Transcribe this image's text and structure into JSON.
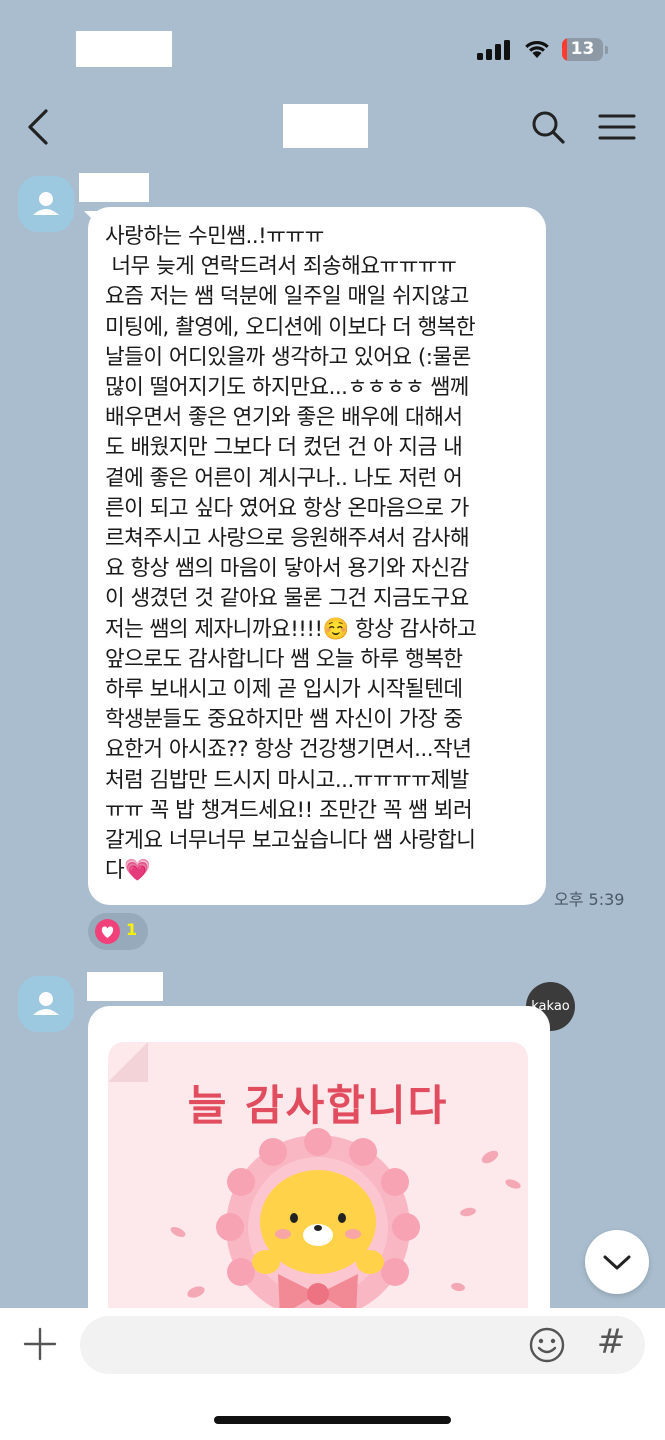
{
  "status_bar": {
    "battery_level": "13",
    "battery_level_fraction": 0.13
  },
  "header": {
    "back_icon": "chevron-left-icon",
    "search_icon": "search-icon",
    "menu_icon": "hamburger-menu-icon"
  },
  "messages": [
    {
      "text": "사랑하는 수민쌤..!ㅠㅠㅠ\n 너무 늦게 연락드려서 죄송해요ㅠㅠㅠㅠ\n요즘 저는 쌤 덕분에 일주일 매일 쉬지않고\n미팅에, 촬영에, 오디션에 이보다 더 행복한\n날들이 어디있을까 생각하고 있어요 (:물론\n많이 떨어지기도 하지만요...ㅎㅎㅎㅎ 쌤께\n배우면서 좋은 연기와 좋은 배우에 대해서\n도 배웠지만 그보다 더 컸던 건 아 지금 내\n곁에 좋은 어른이 계시구나.. 나도 저런 어\n른이 되고 싶다 였어요 항상 온마음으로 가\n르쳐주시고 사랑으로 응원해주셔서 감사해\n요 항상 쌤의 마음이 닿아서 용기와 자신감\n이 생겼던 것 같아요 물론 그건 지금도구요\n저는 쌤의 제자니까요!!!!☺️ 항상 감사하고\n앞으로도 감사합니다 쌤 오늘 하루 행복한\n하루 보내시고 이제 곧 입시가 시작될텐데\n학생분들도 중요하지만 쌤 자신이 가장 중\n요한거 아시죠?? 항상 건강챙기면서...작년\n처럼 김밥만 드시지 마시고...ㅠㅠㅠㅠ제발\nㅠㅠ 꼭 밥 챙겨드세요!! 조만간 꼭 쌤 뵈러\n갈게요 너무너무 보고싶습니다 쌤 사랑합니\n다💗",
      "time": "오후 5:39",
      "reaction": {
        "icon": "heart-icon",
        "count": "1",
        "color": "#f1407a"
      }
    }
  ],
  "sticker": {
    "badge": "kakao",
    "title": "늘 감사합니다"
  },
  "input": {
    "placeholder": "",
    "add_icon": "plus-icon",
    "emoji_icon": "emoji-icon",
    "hash_icon": "#"
  },
  "colors": {
    "background": "#a9bdce",
    "bubble": "#ffffff",
    "avatar": "#9cc9e0",
    "reaction_heart": "#f1407a"
  }
}
